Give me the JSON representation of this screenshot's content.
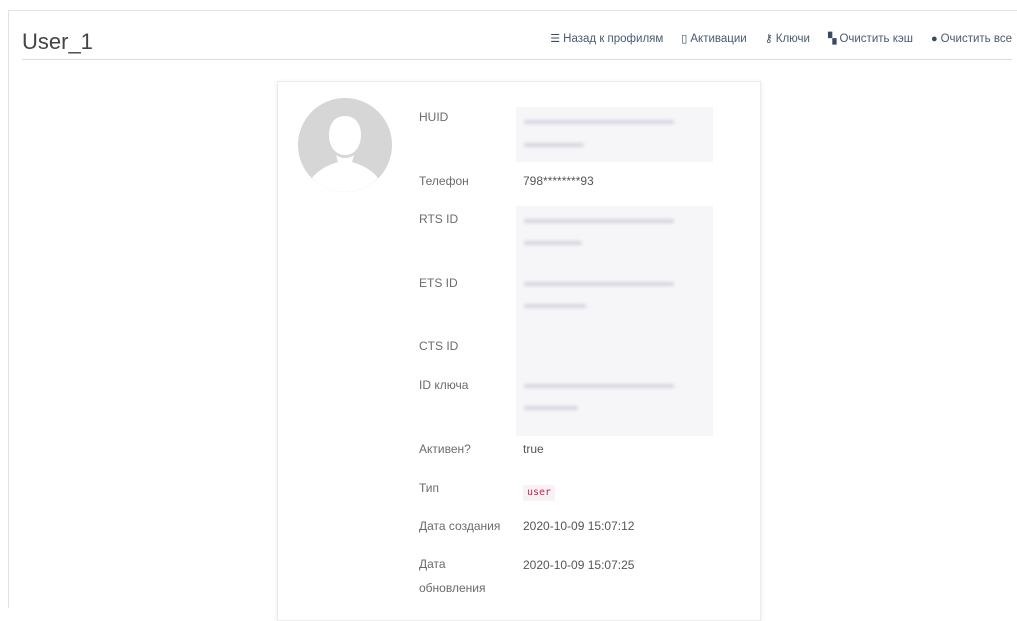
{
  "header": {
    "title": "User_1",
    "nav": [
      {
        "icon": "list-icon",
        "glyph": "☰",
        "label": "Назад к профилям"
      },
      {
        "icon": "mobile-icon",
        "glyph": "▯",
        "label": "Активации"
      },
      {
        "icon": "key-icon",
        "glyph": "⚷",
        "label": "Ключи"
      },
      {
        "icon": "fire-extinguisher-icon",
        "glyph": "▚",
        "label": "Очистить кэш"
      },
      {
        "icon": "bomb-icon",
        "glyph": "●",
        "label": "Очистить все"
      }
    ]
  },
  "profile": {
    "avatar": "user-silhouette-icon",
    "fields": {
      "huid": {
        "label": "HUID",
        "value": ""
      },
      "phone": {
        "label": "Телефон",
        "value": "798********93"
      },
      "rts_id": {
        "label": "RTS ID",
        "value": ""
      },
      "ets_id": {
        "label": "ETS ID",
        "value": ""
      },
      "cts_id": {
        "label": "CTS ID",
        "value": ""
      },
      "key_id": {
        "label": "ID ключа",
        "value": ""
      },
      "active": {
        "label": "Активен?",
        "value": "true"
      },
      "type": {
        "label": "Тип",
        "value": "user"
      },
      "created": {
        "label": "Дата создания",
        "value": "2020-10-09 15:07:12"
      },
      "updated": {
        "label": "Дата обновления",
        "value": "2020-10-09 15:07:25"
      }
    }
  },
  "colors": {
    "badge_text": "#c7254e",
    "badge_bg": "#f9f2f4",
    "nav_text": "#4a5a70"
  }
}
